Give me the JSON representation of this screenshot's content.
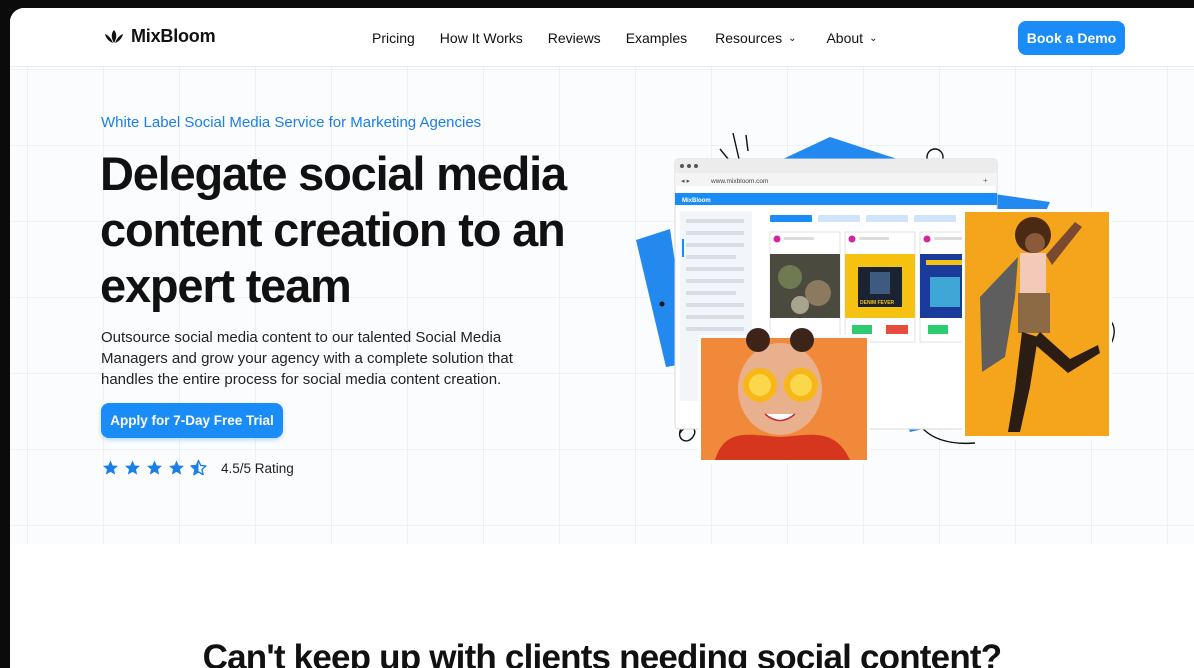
{
  "brand": {
    "name": "MixBloom"
  },
  "nav": {
    "links": [
      {
        "label": "Pricing"
      },
      {
        "label": "How It Works"
      },
      {
        "label": "Reviews"
      },
      {
        "label": "Examples"
      },
      {
        "label": "Resources"
      },
      {
        "label": "About"
      }
    ],
    "cta": "Book a Demo"
  },
  "hero": {
    "eyebrow": "White Label Social Media Service for Marketing Agencies",
    "headline_lines": [
      "Delegate social media",
      "content creation to an",
      "expert team"
    ],
    "description": "Outsource social media content to our talented Social Media Managers and grow your agency with a complete solution that handles the entire process for social media content creation.",
    "cta": "Apply for 7-Day Free Trial",
    "rating": {
      "value": 4.5,
      "max": 5,
      "label": "4.5/5 Rating"
    }
  },
  "mockup": {
    "url": "www.mixbloom.com",
    "app_name": "MixBloom",
    "post_caption": "DENIM FEVER"
  },
  "next_section": {
    "title": "Can't keep up with clients needing social content?"
  },
  "colors": {
    "accent": "#1a8cf7",
    "eyebrow": "#1a7fe8",
    "star": "#1a7fe8"
  }
}
